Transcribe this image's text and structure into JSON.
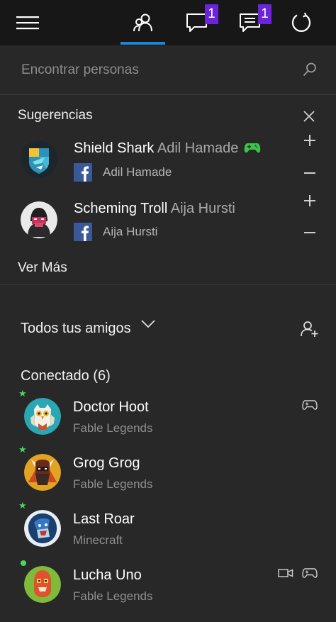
{
  "header": {
    "badges": {
      "messages": "1",
      "activity": "1"
    },
    "colors": {
      "accent": "#1f84d6",
      "badge": "#6b24d8"
    }
  },
  "search": {
    "placeholder": "Encontrar personas"
  },
  "suggestions": {
    "title": "Sugerencias",
    "items": [
      {
        "gamertag": "Shield Shark",
        "real_name": "Adil Hamade",
        "facebook_name": "Adil Hamade",
        "icon": "controller-icon"
      },
      {
        "gamertag": "Scheming Troll",
        "real_name": "Aija Hursti",
        "facebook_name": "Aija Hursti"
      }
    ],
    "see_more": "Ver Más"
  },
  "friends": {
    "filter_label": "Todos tus amigos",
    "online_header": "Conectado (6)",
    "items": [
      {
        "name": "Doctor Hoot",
        "activity": "Fable Legends"
      },
      {
        "name": "Grog Grog",
        "activity": "Fable Legends"
      },
      {
        "name": "Last Roar",
        "activity": "Minecraft"
      },
      {
        "name": "Lucha Uno",
        "activity": "Fable Legends"
      }
    ]
  }
}
